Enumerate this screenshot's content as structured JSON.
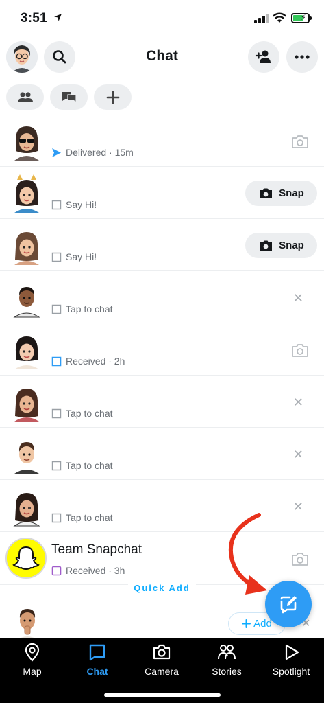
{
  "status_bar": {
    "time": "3:51",
    "location_icon": "location-arrow-icon",
    "battery_color": "#34c759"
  },
  "header": {
    "title": "Chat"
  },
  "chats": [
    {
      "name": "",
      "status_icon": "sent-arrow-icon",
      "status": "Delivered · 15m",
      "action": "camera"
    },
    {
      "name": "",
      "status_icon": "chat-outline-icon",
      "status": "Say Hi!",
      "action": "snap",
      "action_label": "Snap"
    },
    {
      "name": "",
      "status_icon": "chat-outline-icon",
      "status": "Say Hi!",
      "action": "snap",
      "action_label": "Snap"
    },
    {
      "name": "",
      "status_icon": "chat-outline-icon",
      "status": "Tap to chat",
      "action": "close"
    },
    {
      "name": "",
      "status_icon": "chat-received-icon",
      "status": "Received · 2h",
      "action": "camera"
    },
    {
      "name": "",
      "status_icon": "chat-outline-icon",
      "status": "Tap to chat",
      "action": "close"
    },
    {
      "name": "",
      "status_icon": "chat-outline-icon",
      "status": "Tap to chat",
      "action": "close"
    },
    {
      "name": "",
      "status_icon": "chat-outline-icon",
      "status": "Tap to chat",
      "action": "close"
    },
    {
      "name": "Team Snapchat",
      "status_icon": "snap-received-icon",
      "status": "Received · 3h",
      "action": "camera"
    }
  ],
  "quick_add": {
    "label": "Quick Add",
    "add_label": "Add"
  },
  "tabs": [
    {
      "label": "Map",
      "icon": "map-pin-icon"
    },
    {
      "label": "Chat",
      "icon": "chat-bubble-icon",
      "active": true
    },
    {
      "label": "Camera",
      "icon": "camera-icon"
    },
    {
      "label": "Stories",
      "icon": "friends-icon"
    },
    {
      "label": "Spotlight",
      "icon": "play-icon"
    }
  ],
  "colors": {
    "accent": "#2e9cf5",
    "quick_add_blue": "#0eadff",
    "arrow_red": "#e8321c",
    "snapchat_yellow": "#fffc00"
  }
}
